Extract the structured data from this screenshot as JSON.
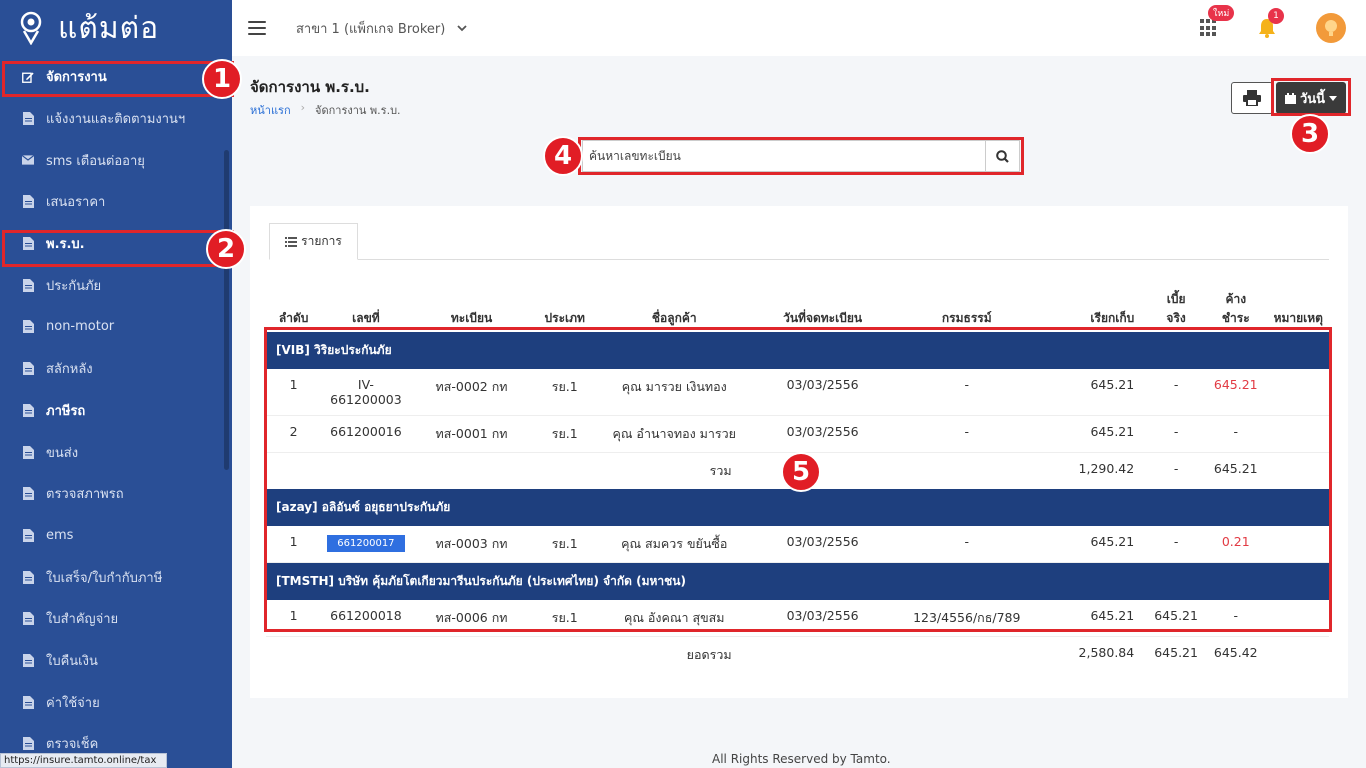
{
  "brand": {
    "name": "แต้มต่อ"
  },
  "sidebar": {
    "items": [
      {
        "label": "จัดการงาน",
        "icon": "edit-icon",
        "bold": true
      },
      {
        "label": "แจ้งงานและติดตามงานฯ",
        "icon": "file-icon"
      },
      {
        "label": "sms เตือนต่ออายุ",
        "icon": "envelope-icon"
      },
      {
        "label": "เสนอราคา",
        "icon": "file-icon"
      },
      {
        "label": "พ.ร.บ.",
        "icon": "file-icon",
        "bold": true
      },
      {
        "label": "ประกันภัย",
        "icon": "file-icon"
      },
      {
        "label": "non-motor",
        "icon": "file-icon"
      },
      {
        "label": "สลักหลัง",
        "icon": "file-icon"
      },
      {
        "label": "ภาษีรถ",
        "icon": "file-icon",
        "bold": true
      },
      {
        "label": "ขนส่ง",
        "icon": "file-icon"
      },
      {
        "label": "ตรวจสภาพรถ",
        "icon": "file-icon"
      },
      {
        "label": "ems",
        "icon": "file-icon"
      },
      {
        "label": "ใบเสร็จ/ใบกำกับภาษี",
        "icon": "file-icon"
      },
      {
        "label": "ใบสำคัญจ่าย",
        "icon": "file-icon"
      },
      {
        "label": "ใบคืนเงิน",
        "icon": "file-icon"
      },
      {
        "label": "ค่าใช้จ่าย",
        "icon": "file-icon"
      },
      {
        "label": "ตรวจเช็ค",
        "icon": "file-icon"
      }
    ]
  },
  "topbar": {
    "branch": "สาขา 1 (แพ็กเกจ Broker)",
    "new_badge": "ใหม่",
    "notification_count": "1"
  },
  "page": {
    "title": "จัดการงาน พ.ร.บ.",
    "breadcrumb_home": "หน้าแรก",
    "breadcrumb_current": "จัดการงาน พ.ร.บ.",
    "today_button": "วันนี้"
  },
  "search": {
    "placeholder": "ค้นหาเลขทะเบียน"
  },
  "tab": {
    "label": "รายการ"
  },
  "table": {
    "headers": [
      "ลำดับ",
      "เลขที่",
      "ทะเบียน",
      "ประเภท",
      "ชื่อลูกค้า",
      "วันที่จดทะเบียน",
      "กรมธรรม์",
      "เรียกเก็บ",
      "เบี้ยจริง",
      "ค้างชำระ",
      "หมายเหตุ"
    ],
    "header_lines": {
      "premium_line1": "เบี้ย",
      "premium_line2": "จริง",
      "outstanding_line1": "ค้าง",
      "outstanding_line2": "ชำระ"
    },
    "groups": [
      {
        "name": "[VIB] วิริยะประกันภัย",
        "rows": [
          {
            "no": "1",
            "doc": "IV-661200003",
            "doc_line1": "IV-",
            "doc_line2": "661200003",
            "plate": "ทส-0002 กท",
            "type": "รย.1",
            "customer": "คุณ มารวย เงินทอง",
            "date": "03/03/2556",
            "policy": "-",
            "charge": "645.21",
            "premium": "-",
            "outstanding": "645.21",
            "outstanding_red": true
          },
          {
            "no": "2",
            "doc": "661200016",
            "plate": "ทส-0001 กท",
            "type": "รย.1",
            "customer": "คุณ อำนาจทอง มารวย",
            "date": "03/03/2556",
            "policy": "-",
            "charge": "645.21",
            "premium": "-",
            "outstanding": "-"
          }
        ],
        "subtotal": {
          "label": "รวม",
          "charge": "1,290.42",
          "premium": "-",
          "outstanding": "645.21"
        }
      },
      {
        "name": "[azay] อลิอันซ์ อยุธยาประกันภัย",
        "rows": [
          {
            "no": "1",
            "doc": "661200017",
            "doc_badge": true,
            "plate": "ทส-0003 กท",
            "type": "รย.1",
            "customer": "คุณ สมควร ขยันซื้อ",
            "date": "03/03/2556",
            "policy": "-",
            "charge": "645.21",
            "premium": "-",
            "outstanding": "0.21",
            "outstanding_red": true
          }
        ]
      },
      {
        "name": "[TMSTH] บริษัท คุ้มภัยโตเกียวมารีนประกันภัย (ประเทศไทย) จำกัด (มหาชน)",
        "rows": [
          {
            "no": "1",
            "doc": "661200018",
            "plate": "ทส-0006 กท",
            "type": "รย.1",
            "customer": "คุณ อังคณา สุขสม",
            "date": "03/03/2556",
            "policy": "123/4556/กธ/789",
            "charge": "645.21",
            "premium": "645.21",
            "outstanding": "-"
          }
        ]
      }
    ],
    "grand_total": {
      "label": "ยอดรวม",
      "charge": "2,580.84",
      "premium": "645.21",
      "outstanding": "645.42"
    }
  },
  "annotations": [
    "1",
    "2",
    "3",
    "4",
    "5"
  ],
  "colors": {
    "sidebar": "#2a4f96",
    "group_header": "#1e3f7e",
    "highlight": "#e0262b",
    "accent_blue": "#2f6fe0",
    "danger": "#e23b44"
  },
  "footer": {
    "text": "All Rights Reserved by Tamto."
  },
  "statusbar": {
    "url": "https://insure.tamto.online/tax"
  }
}
